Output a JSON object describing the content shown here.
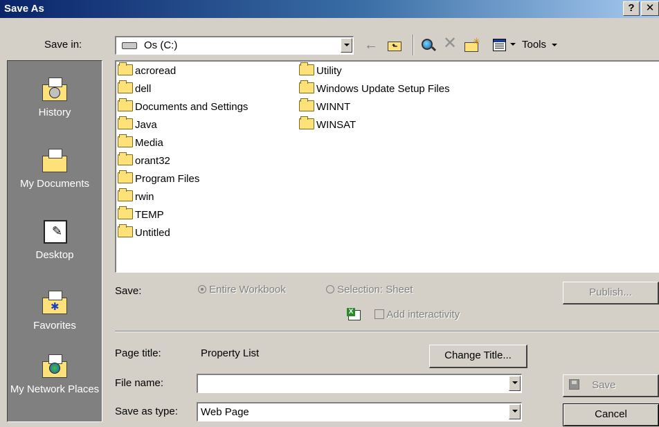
{
  "window": {
    "title": "Save As",
    "help_btn": "?",
    "close_btn": "✕"
  },
  "toolbar": {
    "save_in_label": "Save in:",
    "save_in_value": "Os (C:)",
    "tools_label": "Tools"
  },
  "places": [
    {
      "label": "History"
    },
    {
      "label": "My Documents"
    },
    {
      "label": "Desktop"
    },
    {
      "label": "Favorites"
    },
    {
      "label": "My Network Places"
    }
  ],
  "files": {
    "col1": [
      "acroread",
      "dell",
      "Documents and Settings",
      "Java",
      "Media",
      "orant32",
      "Program Files",
      "rwin",
      "TEMP",
      "Untitled"
    ],
    "col2": [
      "Utility",
      "Windows Update Setup Files",
      "WINNT",
      "WINSAT"
    ]
  },
  "options": {
    "save_label": "Save:",
    "entire_workbook": "Entire Workbook",
    "selection_sheet": "Selection: Sheet",
    "add_interactivity": "Add interactivity",
    "publish_button": "Publish..."
  },
  "form": {
    "page_title_label": "Page title:",
    "page_title_value": "Property List",
    "change_title_button": "Change Title...",
    "file_name_label": "File name:",
    "file_name_value": "",
    "save_as_type_label": "Save as type:",
    "save_as_type_value": "Web Page",
    "save_button": "Save",
    "cancel_button": "Cancel"
  }
}
